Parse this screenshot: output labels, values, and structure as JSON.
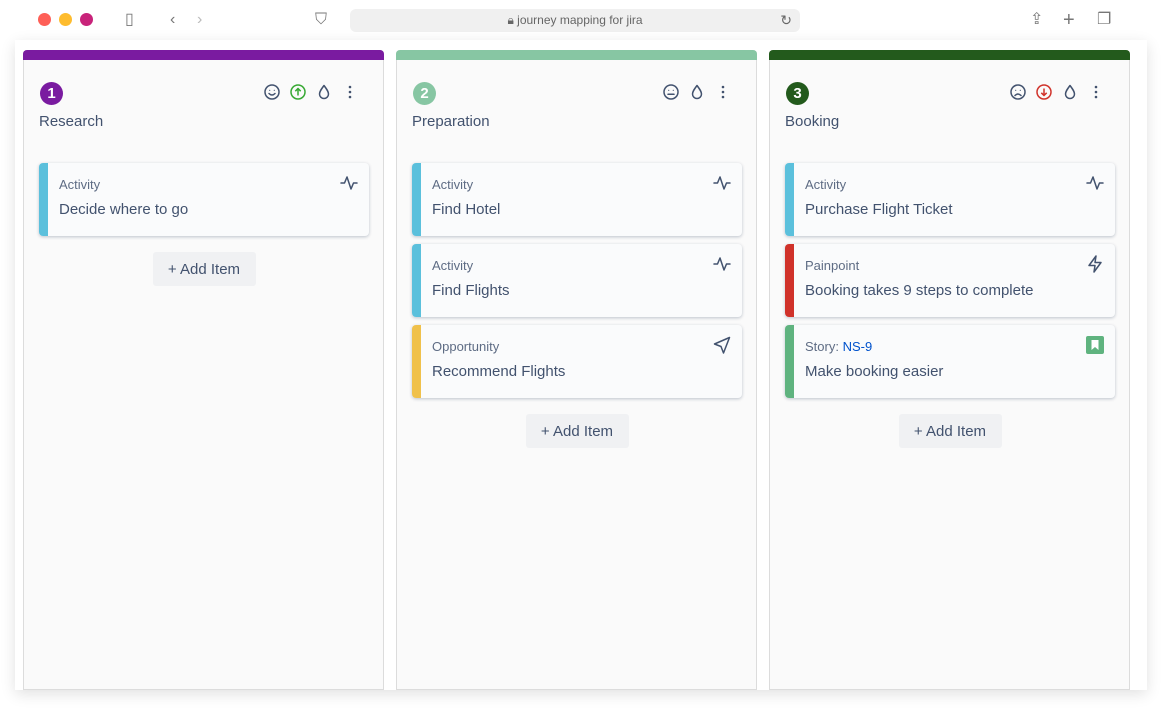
{
  "browser": {
    "url": "journey mapping for jira",
    "traffic": [
      "#fe5f57",
      "#febc2e",
      "#c8237a"
    ]
  },
  "add_item_label": "+ Add Item",
  "columns": [
    {
      "number": "1",
      "title": "Research",
      "color": "#7a1ba0",
      "icons": [
        "smile-icon",
        "arrow-up-circle-icon",
        "drop-icon",
        "more-icon"
      ],
      "cards": [
        {
          "type": "Activity",
          "text": "Decide where to go",
          "color": "#5bc0dc",
          "icon": "activity-icon"
        }
      ]
    },
    {
      "number": "2",
      "title": "Preparation",
      "color": "#87c6a3",
      "icons": [
        "neutral-face-icon",
        "drop-icon",
        "more-icon"
      ],
      "cards": [
        {
          "type": "Activity",
          "text": "Find Hotel",
          "color": "#5bc0dc",
          "icon": "activity-icon"
        },
        {
          "type": "Activity",
          "text": "Find Flights",
          "color": "#5bc0dc",
          "icon": "activity-icon"
        },
        {
          "type": "Opportunity",
          "text": "Recommend Flights",
          "color": "#f0c14b",
          "icon": "send-icon"
        }
      ]
    },
    {
      "number": "3",
      "title": "Booking",
      "color": "#235a1c",
      "icons": [
        "sad-icon",
        "arrow-down-circle-icon",
        "drop-icon",
        "more-icon"
      ],
      "cards": [
        {
          "type": "Activity",
          "text": "Purchase Flight Ticket",
          "color": "#5bc0dc",
          "icon": "activity-icon"
        },
        {
          "type": "Painpoint",
          "text": "Booking takes 9 steps to complete",
          "color": "#d0322a",
          "icon": "lightning-icon"
        },
        {
          "type": "Story:",
          "link": "NS-9",
          "text": "Make booking easier",
          "color": "#5fb37f",
          "icon": "story-icon"
        }
      ]
    }
  ]
}
